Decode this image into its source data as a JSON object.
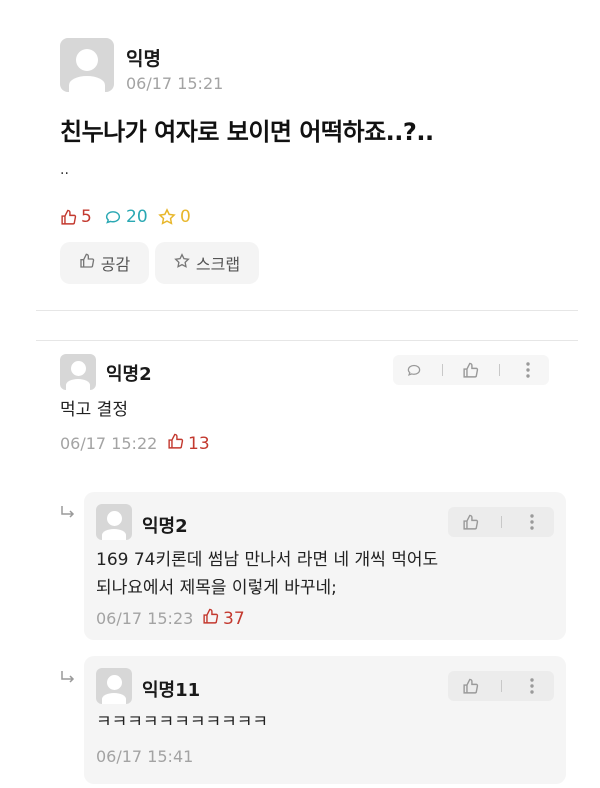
{
  "post": {
    "author": "익명",
    "time": "06/17 15:21",
    "title": "친누나가 여자로 보이면 어떡하죠..?..",
    "body": "..",
    "stats": {
      "likes": "5",
      "comments": "20",
      "scraps": "0"
    },
    "buttons": {
      "like": "공감",
      "scrap": "스크랩"
    },
    "colors": {
      "like": "#c3392f",
      "comment": "#2aa8b3",
      "scrap": "#e8b72c"
    }
  },
  "comments": [
    {
      "author": "익명2",
      "text": "먹고 결정",
      "time": "06/17 15:22",
      "likes": "13"
    }
  ],
  "replies": [
    {
      "author": "익명2",
      "text_line1": "169 74키론데 썸남 만나서 라면 네 개씩 먹어도",
      "text_line2": "되나요에서 제목을 이렇게 바꾸네;",
      "time": "06/17 15:23",
      "likes": "37"
    },
    {
      "author": "익명11",
      "text": "ㅋㅋㅋㅋㅋㅋㅋㅋㅋㅋㅋ",
      "time": "06/17 15:41"
    }
  ]
}
